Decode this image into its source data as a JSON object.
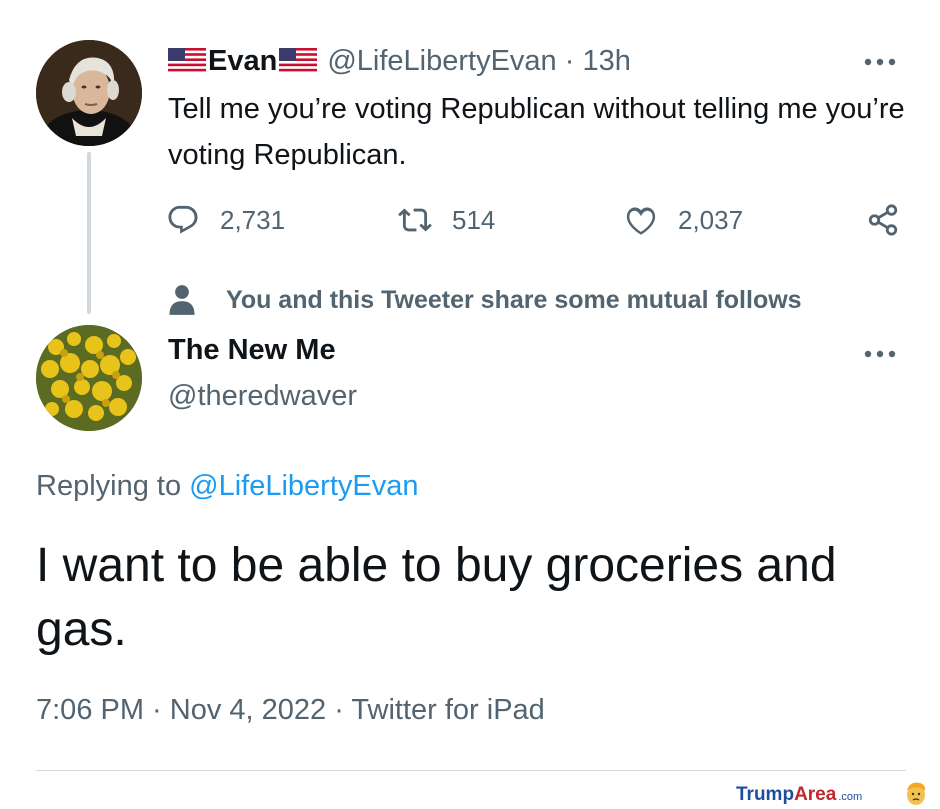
{
  "tweet1": {
    "display_name": "Evan",
    "handle": "@LifeLibertyEvan",
    "time": "13h",
    "separator": "·",
    "text": "Tell me you’re voting Republican without telling me you’re voting Republican.",
    "more_icon": "more-dots-icon",
    "actions": {
      "replies": "2,731",
      "retweets": "514",
      "likes": "2,037"
    }
  },
  "mutual_follows": "You and this Tweeter share some mutual follows",
  "tweet2": {
    "display_name": "The New Me",
    "handle": "@theredwaver",
    "replying_prefix": "Replying to ",
    "replying_to": "@LifeLibertyEvan",
    "text": "I want to be able to buy groceries and gas.",
    "meta": "7:06 PM · Nov 4, 2022 · Twitter for iPad"
  },
  "watermark": {
    "part1": "Trump",
    "part2": "Area",
    "suffix": ".com"
  },
  "colors": {
    "text": "#0f1419",
    "secondary": "#536471",
    "link": "#1d9bf0",
    "divider": "#cfd9de"
  }
}
